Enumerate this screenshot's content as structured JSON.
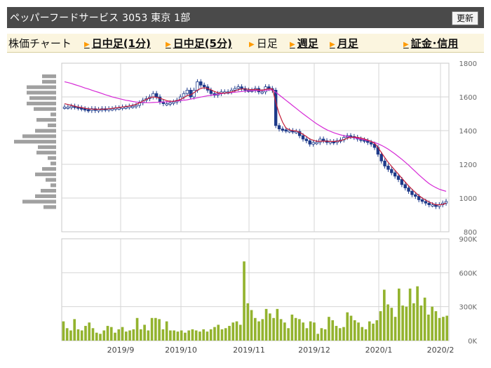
{
  "header": {
    "title": "ペッパーフードサービス 3053 東京 1部",
    "refresh_label": "更新"
  },
  "nav": {
    "chart_label": "株価チャート",
    "items": [
      {
        "label": "日中足(1分)",
        "link": true
      },
      {
        "label": "日中足(5分)",
        "link": true
      },
      {
        "label": "日足",
        "link": false
      },
      {
        "label": "週足",
        "link": true
      },
      {
        "label": "月足",
        "link": true
      },
      {
        "label": "証金･信用",
        "link": true
      }
    ]
  },
  "chart_data": [
    {
      "type": "candlestick",
      "title": "",
      "ylim": [
        800,
        1800
      ],
      "y_ticks": [
        "1800",
        "1600",
        "1400",
        "1200",
        "1000",
        "800"
      ],
      "x_ticks": [
        "2019/9",
        "2019/10",
        "2019/11",
        "2019/12",
        "2020/1",
        "2020/2"
      ],
      "grid": true,
      "close_series": [
        1540,
        1540,
        1545,
        1540,
        1535,
        1530,
        1525,
        1520,
        1530,
        1520,
        1525,
        1530,
        1525,
        1530,
        1530,
        1535,
        1535,
        1540,
        1540,
        1545,
        1545,
        1550,
        1565,
        1580,
        1590,
        1600,
        1620,
        1600,
        1570,
        1560,
        1560,
        1565,
        1570,
        1580,
        1600,
        1620,
        1640,
        1600,
        1640,
        1690,
        1670,
        1660,
        1640,
        1620,
        1610,
        1620,
        1630,
        1630,
        1630,
        1640,
        1650,
        1660,
        1650,
        1640,
        1640,
        1640,
        1650,
        1630,
        1630,
        1660,
        1650,
        1640,
        1430,
        1410,
        1405,
        1400,
        1400,
        1395,
        1395,
        1370,
        1350,
        1340,
        1320,
        1330,
        1330,
        1350,
        1340,
        1330,
        1335,
        1330,
        1340,
        1345,
        1360,
        1370,
        1365,
        1360,
        1350,
        1345,
        1340,
        1330,
        1320,
        1300,
        1260,
        1220,
        1190,
        1170,
        1150,
        1130,
        1110,
        1080,
        1060,
        1040,
        1020,
        1010,
        990,
        980,
        970,
        960,
        960,
        950,
        960,
        970,
        980
      ],
      "ma_short": [
        1560,
        1555,
        1550,
        1545,
        1540,
        1537,
        1533,
        1530,
        1528,
        1527,
        1527,
        1527,
        1528,
        1530,
        1532,
        1535,
        1537,
        1540,
        1543,
        1546,
        1550,
        1556,
        1565,
        1575,
        1585,
        1595,
        1600,
        1598,
        1592,
        1585,
        1578,
        1574,
        1574,
        1578,
        1585,
        1595,
        1608,
        1612,
        1625,
        1640,
        1650,
        1655,
        1650,
        1642,
        1632,
        1625,
        1622,
        1623,
        1625,
        1630,
        1636,
        1643,
        1647,
        1647,
        1645,
        1643,
        1645,
        1642,
        1640,
        1645,
        1648,
        1648,
        1570,
        1500,
        1450,
        1415,
        1405,
        1400,
        1398,
        1390,
        1378,
        1365,
        1350,
        1343,
        1337,
        1337,
        1338,
        1337,
        1336,
        1336,
        1337,
        1340,
        1347,
        1355,
        1360,
        1362,
        1360,
        1356,
        1351,
        1344,
        1336,
        1325,
        1300,
        1270,
        1240,
        1212,
        1188,
        1165,
        1142,
        1118,
        1095,
        1072,
        1052,
        1033,
        1015,
        1000,
        988,
        977,
        968,
        961,
        960,
        962,
        970
      ],
      "ma_long": [
        1690,
        1685,
        1680,
        1673,
        1667,
        1660,
        1653,
        1647,
        1640,
        1633,
        1627,
        1620,
        1613,
        1607,
        1600,
        1595,
        1590,
        1585,
        1580,
        1577,
        1573,
        1570,
        1568,
        1567,
        1566,
        1566,
        1567,
        1568,
        1569,
        1570,
        1571,
        1572,
        1574,
        1576,
        1578,
        1580,
        1583,
        1587,
        1591,
        1595,
        1599,
        1603,
        1607,
        1610,
        1613,
        1616,
        1619,
        1622,
        1624,
        1626,
        1628,
        1630,
        1632,
        1634,
        1636,
        1637,
        1638,
        1638,
        1638,
        1640,
        1641,
        1642,
        1628,
        1612,
        1596,
        1580,
        1564,
        1548,
        1532,
        1516,
        1500,
        1485,
        1470,
        1455,
        1441,
        1428,
        1416,
        1405,
        1396,
        1388,
        1381,
        1375,
        1370,
        1366,
        1362,
        1358,
        1354,
        1350,
        1346,
        1341,
        1336,
        1330,
        1322,
        1313,
        1302,
        1290,
        1276,
        1262,
        1246,
        1230,
        1213,
        1195,
        1176,
        1157,
        1138,
        1120,
        1102,
        1086,
        1073,
        1062,
        1052,
        1046,
        1040
      ],
      "volume_profile_bars": [
        20,
        20,
        42,
        42,
        38,
        42,
        32,
        8,
        28,
        12,
        30,
        48,
        60,
        26,
        28,
        12,
        8,
        20,
        30,
        15,
        8,
        22,
        30,
        48,
        18
      ]
    },
    {
      "type": "bar",
      "title": "",
      "ylim": [
        0,
        900000
      ],
      "y_ticks": [
        "900K",
        "600K",
        "300K",
        "0K"
      ],
      "x_ticks": [
        "2019/9",
        "2019/10",
        "2019/11",
        "2019/12",
        "2020/1",
        "2020/2"
      ],
      "grid": true,
      "values": [
        170000,
        110000,
        90000,
        190000,
        100000,
        90000,
        130000,
        160000,
        110000,
        70000,
        60000,
        90000,
        130000,
        120000,
        70000,
        100000,
        120000,
        80000,
        90000,
        100000,
        200000,
        100000,
        140000,
        90000,
        200000,
        200000,
        190000,
        100000,
        170000,
        90000,
        90000,
        80000,
        90000,
        70000,
        90000,
        100000,
        90000,
        80000,
        100000,
        80000,
        100000,
        120000,
        140000,
        100000,
        110000,
        130000,
        160000,
        170000,
        140000,
        700000,
        330000,
        270000,
        200000,
        170000,
        190000,
        280000,
        240000,
        200000,
        280000,
        190000,
        160000,
        110000,
        230000,
        200000,
        190000,
        160000,
        110000,
        170000,
        160000,
        60000,
        110000,
        100000,
        210000,
        180000,
        130000,
        110000,
        120000,
        250000,
        220000,
        180000,
        160000,
        120000,
        100000,
        170000,
        150000,
        180000,
        260000,
        450000,
        320000,
        290000,
        210000,
        460000,
        310000,
        300000,
        460000,
        330000,
        480000,
        310000,
        380000,
        230000,
        300000,
        260000,
        200000,
        210000,
        220000
      ]
    }
  ]
}
